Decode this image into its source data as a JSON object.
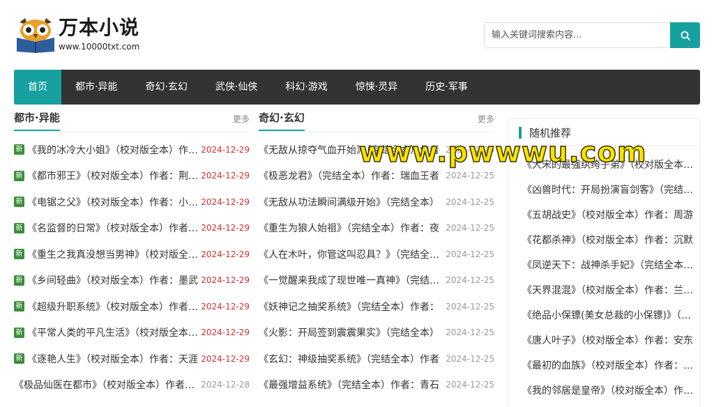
{
  "header": {
    "logo_title": "万本小说",
    "logo_url": "www.10000txt.com",
    "search_placeholder": "输入关键词搜索内容..."
  },
  "nav": [
    "首页",
    "都市·异能",
    "奇幻·玄幻",
    "武侠·仙侠",
    "科幻·游戏",
    "惊悚·灵异",
    "历史·军事"
  ],
  "col1": {
    "title": "都市·异能",
    "more": "更多",
    "items": [
      {
        "badge": "新",
        "title": "《我的冰冷大小姐》（校对版全本）作者：阿拉伯",
        "date": "2024-12-29"
      },
      {
        "badge": "新",
        "title": "《都市邪王》（校对版全本）作者：荆柯守",
        "date": "2024-12-29"
      },
      {
        "badge": "新",
        "title": "《电锯之父》（校对版全本）作者：小刀锋利",
        "date": "2024-12-29"
      },
      {
        "badge": "新",
        "title": "《名监督的日常》（校对版全本）作者：鸡蛋",
        "date": "2024-12-29"
      },
      {
        "badge": "新",
        "title": "《重生之我真没想当男神》（校对版全本）",
        "date": "2024-12-29"
      },
      {
        "badge": "新",
        "title": "《乡间轻曲》（校对版全本）作者：墨武",
        "date": "2024-12-29"
      },
      {
        "badge": "新",
        "title": "《超级升职系统》（校对版全本）作者：红薯",
        "date": "2024-12-29"
      },
      {
        "badge": "新",
        "title": "《平常人类的平凡生活》（校对版全本）作者",
        "date": "2024-12-29"
      },
      {
        "badge": "新",
        "title": "《逐艳人生》（校对版全本）作者：天涯",
        "date": "2024-12-29"
      },
      {
        "badge": "",
        "title": "《极品仙医在都市》（校对版全本）作者：江湖",
        "date": "2024-12-28"
      }
    ]
  },
  "col2": {
    "title": "奇幻·玄幻",
    "more": "更多",
    "items": [
      {
        "title": "《无敌从掠夺气血开始》（完结全本）作者",
        "date": "2024-12-25"
      },
      {
        "title": "《极恶龙君》（完结全本）作者：瑞血王者",
        "date": "2024-12-25"
      },
      {
        "title": "《无敌从功法瞬间满级开始》（完结全本）",
        "date": "2024-12-25"
      },
      {
        "title": "《重生为狼人始祖》（完结全本）作者：夜",
        "date": "2024-12-25"
      },
      {
        "title": "《人在木叶，你管这叫忍具？》（完结全本）",
        "date": "2024-12-25"
      },
      {
        "title": "《一觉醒来我成了现世唯一真神》（完结全本）",
        "date": "2024-12-25"
      },
      {
        "title": "《妖神记之抽奖系统》（完结全本）作者：",
        "date": "2024-12-25"
      },
      {
        "title": "《火影：开局签到震震果实》（完结全本）",
        "date": "2024-12-25"
      },
      {
        "title": "《玄幻：神级抽奖系统》（完结全本）作者",
        "date": "2024-12-25"
      },
      {
        "title": "《最强增益系统》（完结全本）作者：青石",
        "date": "2024-12-25"
      }
    ]
  },
  "side": {
    "title": "随机推荐",
    "items": [
      "《大宋的最强纨绔子弟》（校对版全本）作者",
      "《凶兽时代：开局扮演盲剑客》（完结全本）",
      "《五胡战史》（校对版全本）作者：周游",
      "《花都杀神》（校对版全本）作者：沉默",
      "《凤逆天下：战神杀手妃》（完结全本）作者",
      "《天界混混》（校对版全本）作者：兰帝魅晨",
      "《绝品小保镖(美女总裁的小保镖)》（校对版）",
      "《唐人叶子》（校对版全本）作者：安东",
      "《最初的血族》（校对版全本）作者：小鱼",
      "《我的邻居是皇帝》（校对版全本）作者："
    ]
  },
  "watermark": "www.pwwwu.com",
  "colors": {
    "accent": "#17a0a0",
    "nav_bg": "#333333",
    "badge": "#3a8f3a",
    "date_red": "#d32f2f"
  }
}
